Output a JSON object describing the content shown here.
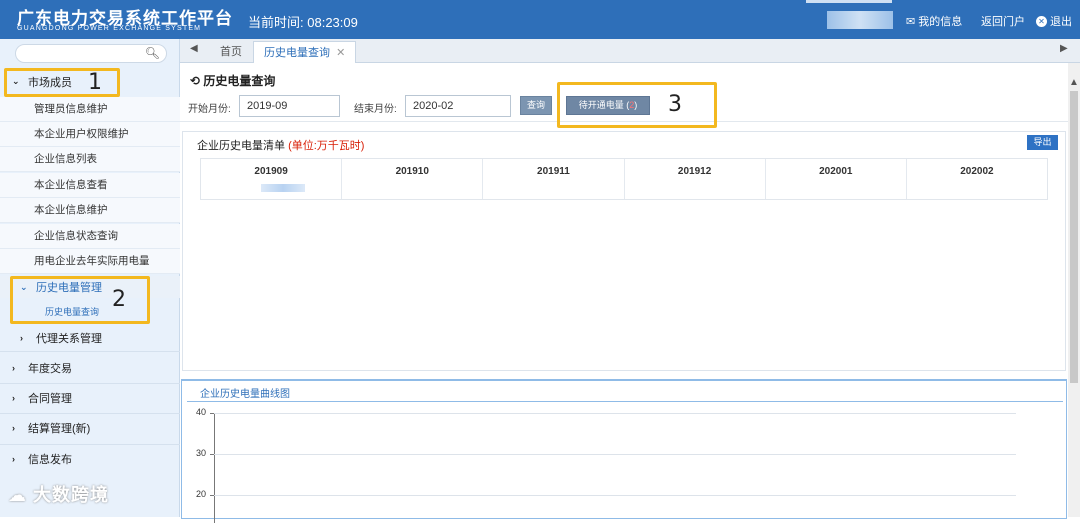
{
  "header": {
    "title": "广东电力交易系统工作平台",
    "subtitle": "GUANGDONG POWER EXCHANGE SYSTEM",
    "time_label": "当前时间:",
    "time_value": "08:23:09",
    "my_info": "我的信息",
    "return_portal": "返回门户",
    "logout": "退出"
  },
  "sidebar": {
    "search_placeholder": "",
    "group_market": "市场成员",
    "market_items": [
      "管理员信息维护",
      "本企业用户权限维护",
      "企业信息列表",
      "本企业信息查看",
      "本企业信息维护",
      "企业信息状态查询",
      "用电企业去年实际用电量"
    ],
    "history_group": "历史电量管理",
    "history_item": "历史电量查询",
    "agency": "代理关系管理",
    "groups": [
      "年度交易",
      "合同管理",
      "结算管理(新)",
      "信息发布"
    ]
  },
  "tabs": {
    "home": "首页",
    "active": "历史电量查询"
  },
  "page": {
    "title": "历史电量查询",
    "start_label": "开始月份:",
    "start_value": "2019-09",
    "end_label": "结束月份:",
    "end_value": "2020-02",
    "query_button": "查询",
    "pending_button": "待开通电量",
    "pending_count": "2",
    "list_title": "企业历史电量清单",
    "unit": "(单位:万千瓦时)",
    "export": "导出",
    "columns": [
      "201909",
      "201910",
      "201911",
      "201912",
      "202001",
      "202002"
    ],
    "chart_title": "企业历史电量曲线图"
  },
  "chart_data": {
    "type": "line",
    "title": "企业历史电量曲线图",
    "yticks": [
      "40",
      "30",
      "20"
    ],
    "ylim": [
      20,
      40
    ]
  },
  "annotations": [
    "1",
    "2",
    "3"
  ],
  "watermark": "大数跨境"
}
